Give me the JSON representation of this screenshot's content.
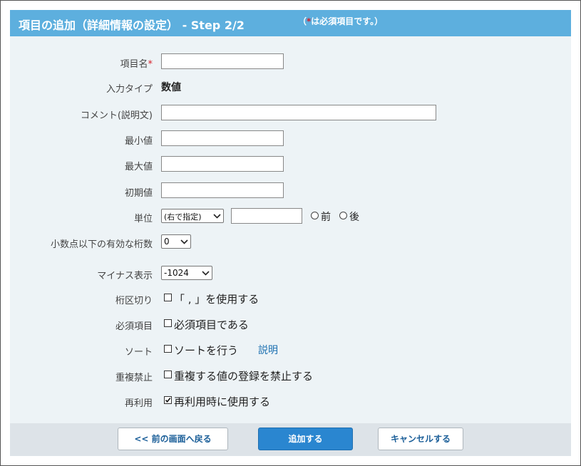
{
  "header": {
    "title": "項目の追加（詳細情報の設定） - Step 2/2",
    "note_open": "（",
    "note_star": "*",
    "note_text": "は必須項目です。）"
  },
  "form": {
    "item_name": {
      "label": "項目名",
      "required_mark": "*",
      "value": ""
    },
    "input_type": {
      "label": "入力タイプ",
      "value": "数値"
    },
    "comment": {
      "label": "コメント(説明文)",
      "value": ""
    },
    "min_value": {
      "label": "最小値",
      "value": ""
    },
    "max_value": {
      "label": "最大値",
      "value": ""
    },
    "initial_value": {
      "label": "初期値",
      "value": ""
    },
    "unit": {
      "label": "単位",
      "select_value": "(右で指定)",
      "text_value": "",
      "radio_before": "前",
      "radio_after": "後"
    },
    "decimal_digits": {
      "label": "小数点以下の有効な桁数",
      "select_value": "0"
    },
    "negative_display": {
      "label": "マイナス表示",
      "select_value": "-1024"
    },
    "digit_separator": {
      "label": "桁区切り",
      "option": "「 , 」を使用する",
      "checked": false
    },
    "required": {
      "label": "必須項目",
      "option": "必須項目である",
      "checked": false
    },
    "sort": {
      "label": "ソート",
      "option": "ソートを行う",
      "checked": false,
      "help_link": "説明"
    },
    "no_duplicate": {
      "label": "重複禁止",
      "option": "重複する値の登録を禁止する",
      "checked": false
    },
    "reuse": {
      "label": "再利用",
      "option": "再利用時に使用する",
      "checked": true
    }
  },
  "footer": {
    "back_label": "<< 前の画面へ戻る",
    "add_label": "追加する",
    "cancel_label": "キャンセルする"
  },
  "colors": {
    "header_bg": "#5dafde",
    "panel_bg": "#edf3f6",
    "required_star": "#d6202a",
    "primary_button": "#2a86d0",
    "link": "#1a6fb0"
  }
}
